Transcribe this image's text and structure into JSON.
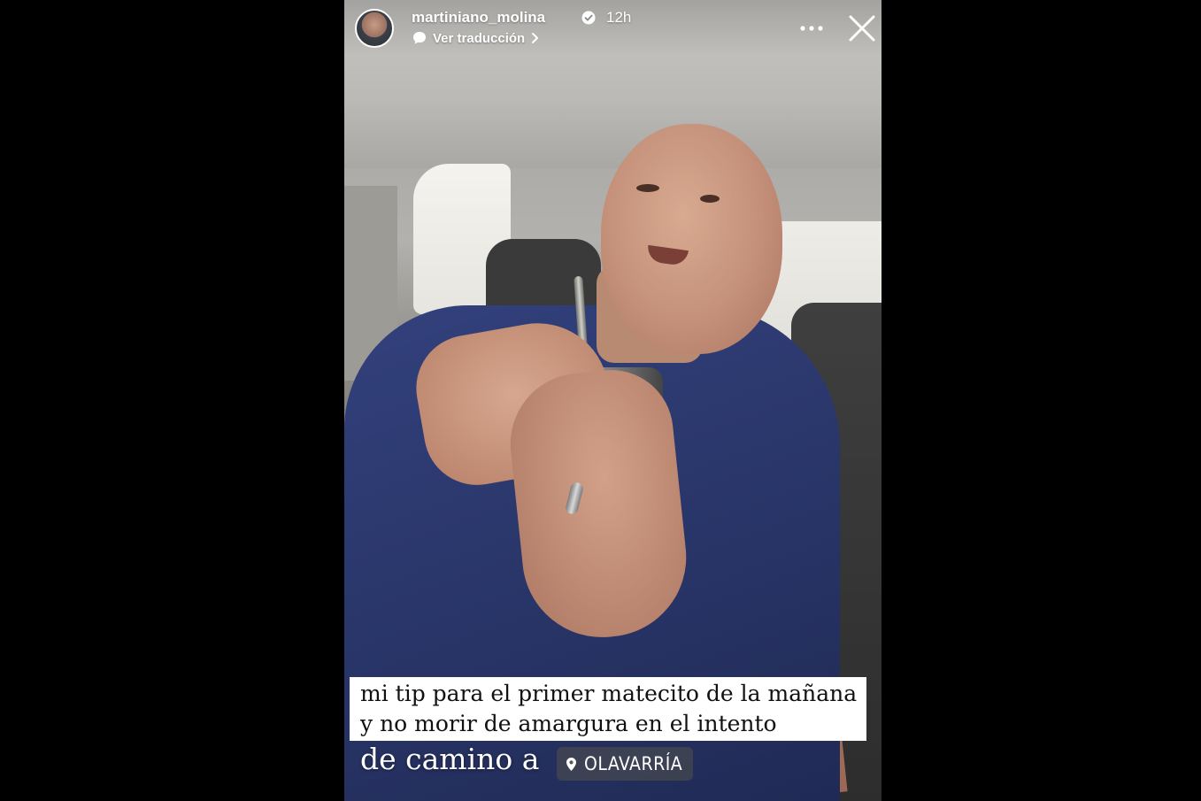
{
  "story": {
    "username": "martiniano_molina",
    "verified": true,
    "time_ago": "12h",
    "translate_label": "Ver traducción",
    "caption_lines": [
      "mi tip para el primer matecito de la mañana",
      "y no morir de amargura en el intento"
    ],
    "route_text": "de camino a",
    "location_sticker": "OLAVARRÍA"
  },
  "icons": {
    "verified": "verified-badge-icon",
    "translate": "speech-bubble-icon",
    "chevron": "chevron-right-icon",
    "more": "more-horizontal-icon",
    "close": "close-icon",
    "location": "location-pin-icon"
  },
  "colors": {
    "background": "#000000",
    "text": "#ffffff",
    "caption_bg": "#ffffff",
    "caption_text": "#111111",
    "sticker_bg": "#464850"
  }
}
